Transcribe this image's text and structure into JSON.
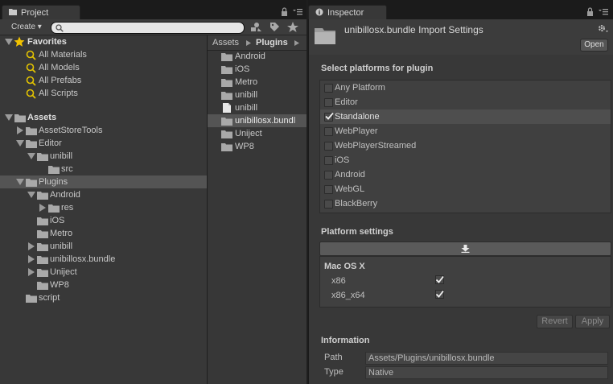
{
  "project_tab": {
    "label": "Project"
  },
  "inspector_tab": {
    "label": "Inspector"
  },
  "toolbar": {
    "create_label": "Create ▾"
  },
  "favorites": {
    "label": "Favorites",
    "items": [
      "All Materials",
      "All Models",
      "All Prefabs",
      "All Scripts"
    ]
  },
  "tree": {
    "assets": "Assets",
    "asset_store_tools": "AssetStoreTools",
    "editor": "Editor",
    "editor_unibill": "unibill",
    "editor_src": "src",
    "plugins": "Plugins",
    "android": "Android",
    "res": "res",
    "ios": "iOS",
    "metro": "Metro",
    "unibill": "unibill",
    "unibillosx": "unibillosx.bundle",
    "uniject": "Uniject",
    "wp8": "WP8",
    "script": "script"
  },
  "breadcrumb": {
    "root": "Assets",
    "current": "Plugins"
  },
  "files": [
    "Android",
    "iOS",
    "Metro",
    "unibill",
    "unibill",
    "unibillosx.bundl",
    "Uniject",
    "WP8"
  ],
  "inspector": {
    "title": "unibillosx.bundle Import Settings",
    "open_label": "Open",
    "select_platforms_title": "Select platforms for plugin",
    "platforms": [
      {
        "name": "Any Platform",
        "checked": false
      },
      {
        "name": "Editor",
        "checked": false
      },
      {
        "name": "Standalone",
        "checked": true
      },
      {
        "name": "WebPlayer",
        "checked": false
      },
      {
        "name": "WebPlayerStreamed",
        "checked": false
      },
      {
        "name": "iOS",
        "checked": false
      },
      {
        "name": "Android",
        "checked": false
      },
      {
        "name": "WebGL",
        "checked": false
      },
      {
        "name": "BlackBerry",
        "checked": false
      }
    ],
    "platform_settings_title": "Platform settings",
    "mac_title": "Mac OS X",
    "arch": [
      {
        "name": "x86",
        "checked": true
      },
      {
        "name": "x86_x64",
        "checked": true
      }
    ],
    "revert_label": "Revert",
    "apply_label": "Apply",
    "information_title": "Information",
    "path_label": "Path",
    "path_value": "Assets/Plugins/unibillosx.bundle",
    "type_label": "Type",
    "type_value": "Native"
  },
  "colors": {
    "accent_star": "#f2c200",
    "search_icon": "#e4c400",
    "selection": "#545454"
  }
}
